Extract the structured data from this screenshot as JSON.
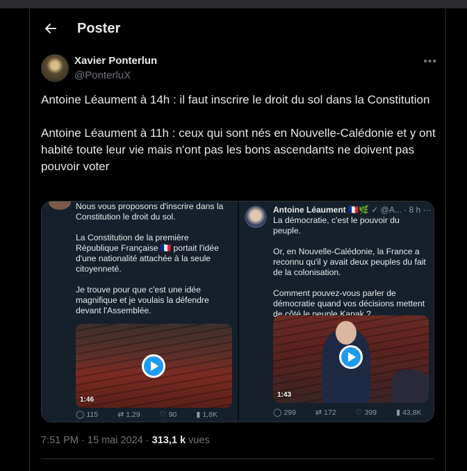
{
  "header": {
    "title": "Poster",
    "back_icon": "arrow-left-icon"
  },
  "author": {
    "display_name": "Xavier Ponterlun",
    "handle": "@PonterluX",
    "more_icon": "more-horizontal-icon"
  },
  "tweet": {
    "paragraphs": [
      "Antoine Léaument à 14h : il faut inscrire le droit du sol dans la Constitution",
      "Antoine Léaument à 11h : ceux qui sont nés en Nouvelle-Calédonie et y ont habité toute leur vie mais n'ont pas les bons ascendants ne doivent pas pouvoir voter"
    ]
  },
  "media": {
    "left": {
      "paragraphs": [
        "Nous vous proposons d'inscrire dans la Constitution le droit du sol.",
        "La Constitution de la première République Française 🇫🇷 portait l'idée d'une nationalité attachée à la seule citoyenneté.",
        "Je trouve pour que c'est une idée magnifique et je voulais la défendre devant l'Assemblée."
      ],
      "video_duration": "1:46",
      "stats": {
        "replies": "115",
        "reposts": "1,29",
        "likes": "90",
        "views": "1,8K"
      }
    },
    "right": {
      "name": "Antoine Léaument",
      "flags": "🇫🇷🌿",
      "meta": "@A... · 8 h",
      "paragraphs": [
        "La démocratie, c'est le pouvoir du peuple.",
        "Or, en Nouvelle-Calédonie, la France a reconnu qu'il y avait deux peuples du fait de la colonisation.",
        "Comment pouvez-vous parler de démocratie quand vos décisions mettent de côté le peuple Kanak ?"
      ],
      "video_duration": "1:43",
      "stats": {
        "replies": "299",
        "reposts": "172",
        "likes": "399",
        "views": "43,8K"
      }
    }
  },
  "meta": {
    "time": "7:51 PM",
    "separator": "·",
    "date": "15 mai 2024",
    "separator2": "·",
    "views_count": "313,1 k",
    "views_label": "vues"
  },
  "colors": {
    "background": "#000000",
    "text": "#e7e9ea",
    "muted": "#71767b",
    "accent": "#1d9bf0",
    "border": "#2f3336"
  }
}
